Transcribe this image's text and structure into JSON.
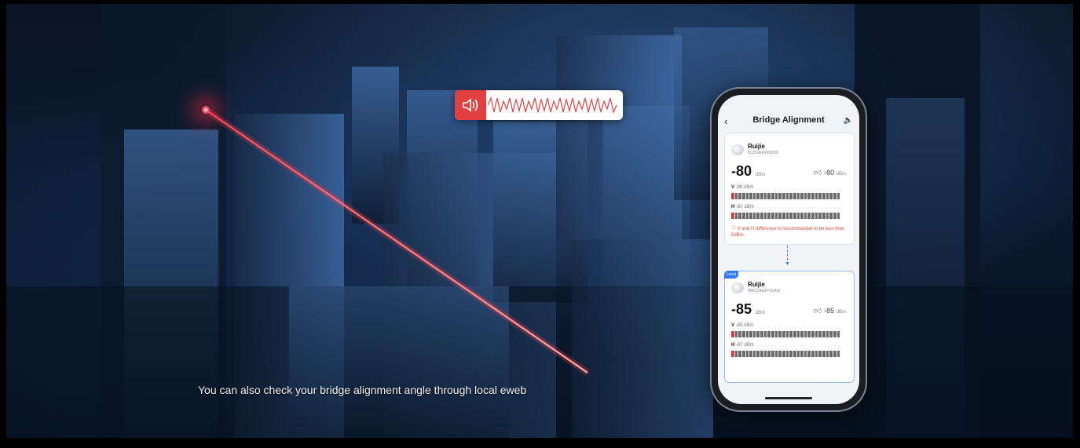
{
  "subtitle": "You can also check your bridge alignment angle through local eweb",
  "audio": {
    "icon": "speaker-icon",
    "accent": "#e04040"
  },
  "phone": {
    "title": "Bridge Alignment",
    "remote": {
      "name": "Ruijie",
      "serial": "G1S5A0F000200",
      "signal": "-80",
      "signal_unit": "dBm",
      "best": "-80",
      "best_unit": "dBm",
      "v_label": "V",
      "v_value": "-88 dBm",
      "h_label": "H",
      "h_value": "-80 dBm",
      "warning": "V and H difference is recommended to be less than 5dBm"
    },
    "local": {
      "badge": "Local",
      "name": "Ruijie",
      "serial": "MACC4a0FYZH02",
      "signal": "-85",
      "signal_unit": "dBm",
      "best": "-85",
      "best_unit": "dBm",
      "v_label": "V",
      "v_value": "-85 dBm",
      "h_label": "H",
      "h_value": "-87 dBm"
    }
  },
  "colors": {
    "accent": "#3478f6",
    "warning": "#e04a3a",
    "laser": "#ff3a4a"
  }
}
